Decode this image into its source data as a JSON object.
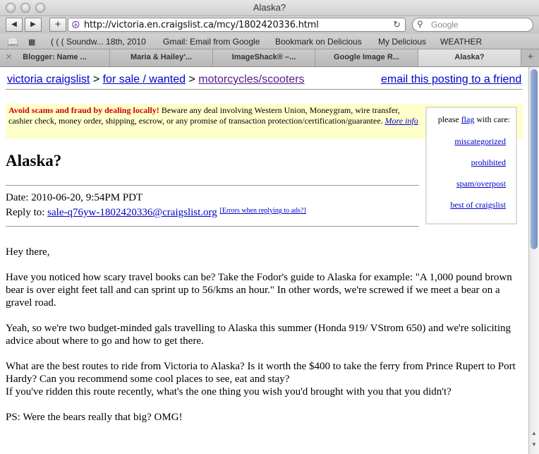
{
  "window": {
    "title": "Alaska?"
  },
  "toolbar": {
    "back": "◀",
    "forward": "▶",
    "add": "+",
    "url": "http://victoria.en.craigslist.ca/mcy/1802420336.html",
    "search_placeholder": "Google"
  },
  "bookmarks": [
    "( ( ( Soundw... 18th, 2010",
    "Gmail: Email from Google",
    "Bookmark on Delicious",
    "My Delicious",
    "WEATHER"
  ],
  "tabs": [
    {
      "label": "Blogger: Name ..."
    },
    {
      "label": "Maria & Hailey'..."
    },
    {
      "label": "ImageShack® –..."
    },
    {
      "label": "Google Image R..."
    },
    {
      "label": "Alaska?"
    }
  ],
  "breadcrumb": {
    "site": "victoria craigslist",
    "sep": ">",
    "category": "for sale / wanted",
    "subcategory": "motorcycles/scooters"
  },
  "email_link": "email this posting to a friend",
  "scam": {
    "warning": "Avoid scams and fraud by dealing locally!",
    "text": " Beware any deal involving Western Union, Moneygram, wire transfer, cashier check, money order, shipping, escrow, or any promise of transaction protection/certification/guarantee. ",
    "more": "More info"
  },
  "flag": {
    "prefix": "please ",
    "link": "flag",
    "suffix": " with care:",
    "items": [
      "miscategorized",
      "prohibited",
      "spam/overpost",
      "best of craigslist"
    ]
  },
  "post": {
    "title": "Alaska?",
    "date": "Date: 2010-06-20, 9:54PM PDT",
    "reply_label": "Reply to: ",
    "reply_email": "sale-q76yw-1802420336@craigslist.org",
    "errors_link": "[Errors when replying to ads?]",
    "paragraphs": [
      "Hey there,",
      "Have you noticed how scary travel books can be? Take the Fodor's guide to Alaska for example: \"A 1,000 pound brown bear is over eight feet tall and can sprint up to 56/kms an hour.\" In other words, we're screwed if we meet a bear on a gravel road.",
      "Yeah, so we're two budget-minded gals travelling to Alaska this summer (Honda 919/ VStrom 650) and we're soliciting advice about where to go and how to get there.",
      "What are the best routes to ride from Victoria to Alaska? Is it worth the $400 to take the ferry from Prince Rupert to Port Hardy? Can you recommend some cool places to see, eat and stay?",
      "If you've ridden this route recently, what's the one thing you wish you'd brought with you that you didn't?",
      "PS: Were the bears really that big? OMG!"
    ]
  }
}
